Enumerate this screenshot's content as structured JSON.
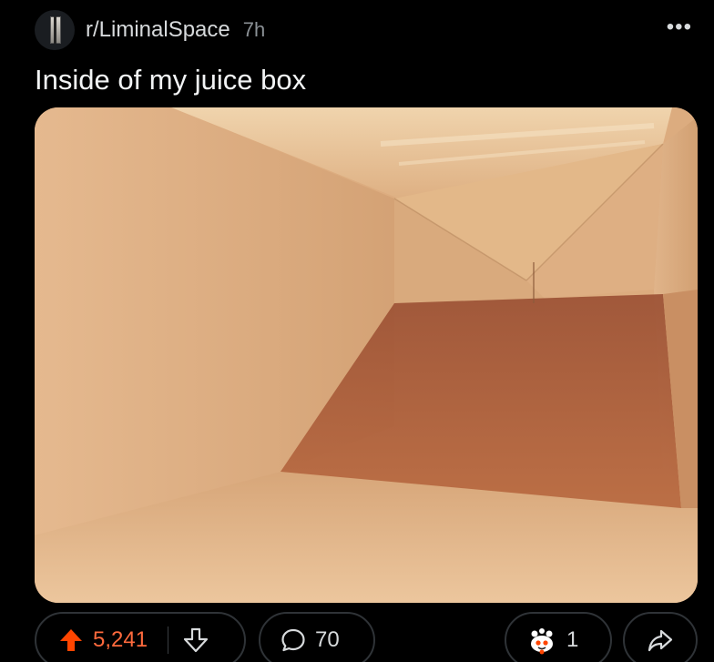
{
  "post": {
    "subreddit": "r/LiminalSpace",
    "age": "7h",
    "more_label": "•••",
    "title": "Inside of my juice box"
  },
  "actions": {
    "upvotes": "5,241",
    "comments": "70",
    "awards": "1"
  },
  "colors": {
    "background": "#000000",
    "upvote_active": "#ff4500",
    "upvote_count": "#ff6a3d",
    "pill_border": "#2f3337"
  },
  "icons": {
    "upvote": "upvote-arrow-icon",
    "downvote": "downvote-arrow-icon",
    "comment": "comment-bubble-icon",
    "award": "award-icon",
    "share": "share-arrow-icon",
    "more": "more-options-icon"
  }
}
